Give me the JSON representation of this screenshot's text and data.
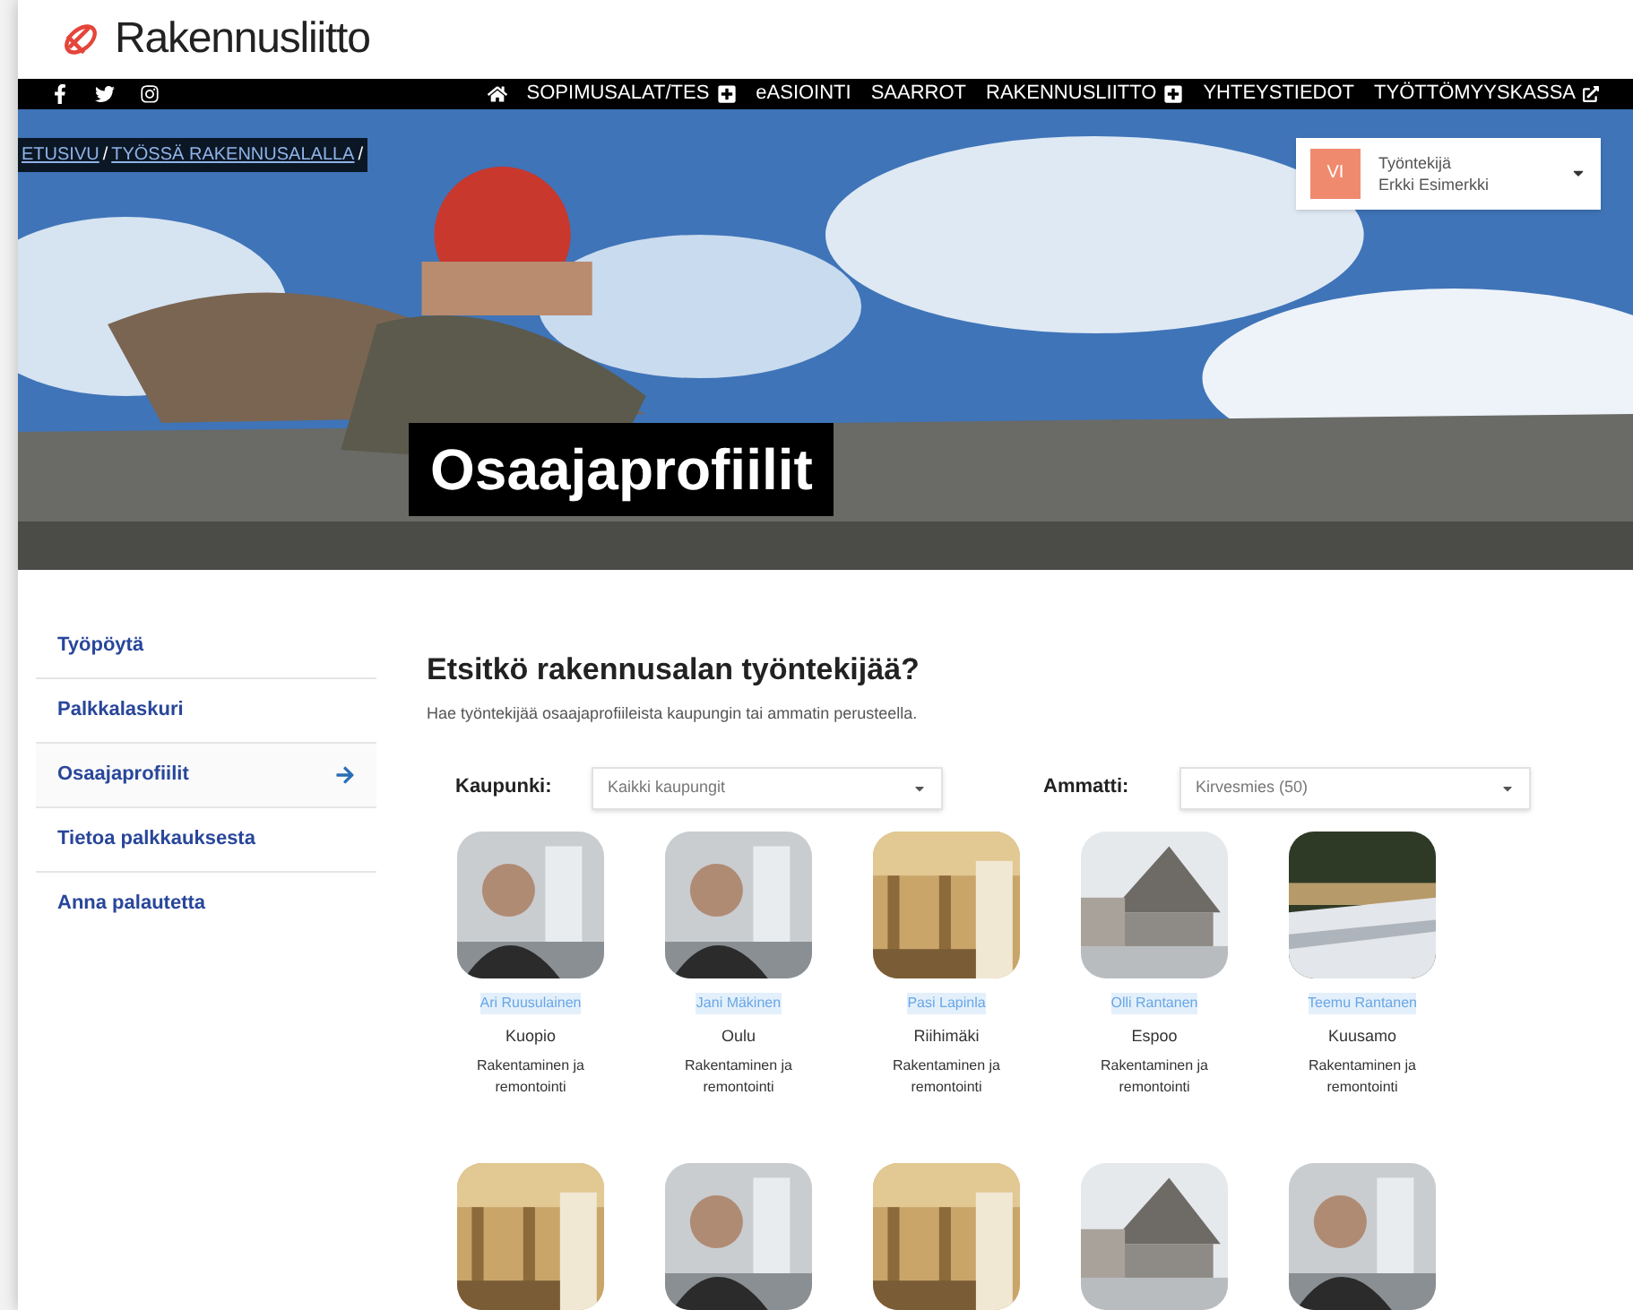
{
  "logo": {
    "text": "Rakennusliitto"
  },
  "nav": {
    "items": [
      {
        "label": "SOPIMUSALAT/TES",
        "kind": "submenu"
      },
      {
        "label": "eASIOINTI",
        "kind": "link"
      },
      {
        "label": "SAARROT",
        "kind": "link"
      },
      {
        "label": "RAKENNUSLIITTO",
        "kind": "submenu"
      },
      {
        "label": "YHTEYSTIEDOT",
        "kind": "link"
      },
      {
        "label": "TYÖTTÖMYYSKASSA",
        "kind": "external"
      }
    ]
  },
  "breadcrumb": [
    {
      "text": "ETUSIVU",
      "kind": "link"
    },
    {
      "text": "/",
      "kind": "separator"
    },
    {
      "text": "TYÖSSÄ RAKENNUSALALLA",
      "kind": "link"
    },
    {
      "text": "/",
      "kind": "separator"
    }
  ],
  "user": {
    "initials": "VI",
    "role": "Työntekijä",
    "name": "Erkki Esimerkki"
  },
  "hero": {
    "title": "Osaajaprofiilit"
  },
  "sidebar": {
    "items": [
      {
        "label": "Työpöytä",
        "selected": false
      },
      {
        "label": "Palkkalaskuri",
        "selected": false
      },
      {
        "label": "Osaajaprofiilit",
        "selected": true
      },
      {
        "label": "Tietoa palkkauksesta",
        "selected": false
      },
      {
        "label": "Anna palautetta",
        "selected": false
      }
    ]
  },
  "heading": "Etsitkö rakennusalan työntekijää?",
  "intro": "Hae työntekijää osaajaprofiileista kaupungin tai ammatin perusteella.",
  "filters": [
    {
      "label": "Kaupunki:",
      "value": "Kaikki kaupungit"
    },
    {
      "label": "Ammatti:",
      "value": "Kirvesmies (50)"
    }
  ],
  "profiles": [
    {
      "name": "Ari Ruusulainen",
      "city": "Kuopio",
      "field": "Rakentaminen ja remontointi"
    },
    {
      "name": "Jani Mäkinen",
      "city": "Oulu",
      "field": "Rakentaminen ja remontointi"
    },
    {
      "name": "Pasi Lapinla",
      "city": "Riihimäki",
      "field": "Rakentaminen ja remontointi"
    },
    {
      "name": "Olli Rantanen",
      "city": "Espoo",
      "field": "Rakentaminen ja remontointi"
    },
    {
      "name": "Teemu Rantanen",
      "city": "Kuusamo",
      "field": "Rakentaminen ja remontointi"
    }
  ]
}
